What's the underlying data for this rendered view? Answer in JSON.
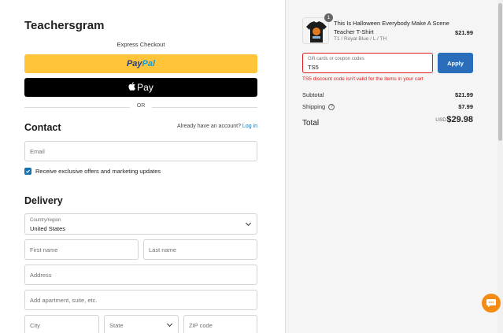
{
  "brand": "Teachersgram",
  "express_checkout": "Express Checkout",
  "paypal": {
    "part1": "Pay",
    "part2": "Pal"
  },
  "applepay": {
    "label": "Pay"
  },
  "or_label": "OR",
  "contact": {
    "title": "Contact",
    "login_prompt": "Already have an account?",
    "login_link": "Log in",
    "email_placeholder": "Email",
    "marketing_label": "Receive exclusive offers and marketing updates"
  },
  "delivery": {
    "title": "Delivery",
    "country_label": "Country/region",
    "country_value": "United States",
    "first_name": "First name",
    "last_name": "Last name",
    "address": "Address",
    "apartment": "Add apartment, suite, etc.",
    "city": "City",
    "state": "State",
    "zip": "ZIP code"
  },
  "order": {
    "quantity": "1",
    "product_title": "This Is Halloween Everybody Make A Scene Teacher T-Shirt",
    "variant": "T1 / Royal Blue / L / TH",
    "price": "$21.99",
    "coupon_label": "Gift cards or coupon codes",
    "coupon_value": "TS5",
    "apply": "Apply",
    "error": "TS5 discount code isn't valid for the items in your cart",
    "subtotal_label": "Subtotal",
    "subtotal": "$21.99",
    "shipping_label": "Shipping",
    "shipping": "$7.99",
    "total_label": "Total",
    "currency": "USD",
    "total": "$29.98"
  },
  "colors": {
    "accent": "#1773b0",
    "paypal": "#ffc43a",
    "error": "#dd1d1d",
    "apply": "#2a6ebb",
    "chat": "#f48c14"
  }
}
